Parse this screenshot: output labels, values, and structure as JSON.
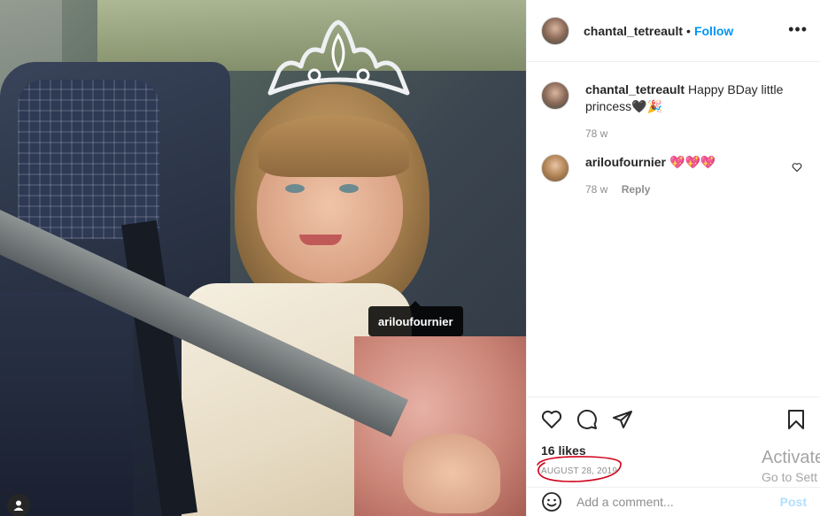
{
  "photo": {
    "tag_username": "ariloufournier"
  },
  "post": {
    "author": "chantal_tetreault",
    "separator": "•",
    "follow_label": "Follow",
    "more_label": "•••",
    "likes": "16 likes",
    "date": "AUGUST 28, 2019"
  },
  "comments": [
    {
      "username": "chantal_tetreault",
      "text": "Happy BDay little princess🖤🎉",
      "age": "78 w",
      "reply": ""
    },
    {
      "username": "ariloufournier",
      "text": "💖💖💖",
      "age": "78 w",
      "reply": "Reply"
    }
  ],
  "add_comment": {
    "placeholder": "Add a comment...",
    "post_label": "Post"
  },
  "watermark": {
    "line1": "Activate",
    "line2": "Go to Sett"
  },
  "icons": {
    "like": "heart-icon",
    "comment": "comment-icon",
    "share": "paper-plane-icon",
    "save": "bookmark-icon",
    "emoji": "smiley-icon",
    "user_tags": "user-tag-icon"
  },
  "colors": {
    "accent": "#0095f6",
    "text": "#262626",
    "muted": "#8e8e8e",
    "annotation": "#d0021b"
  }
}
